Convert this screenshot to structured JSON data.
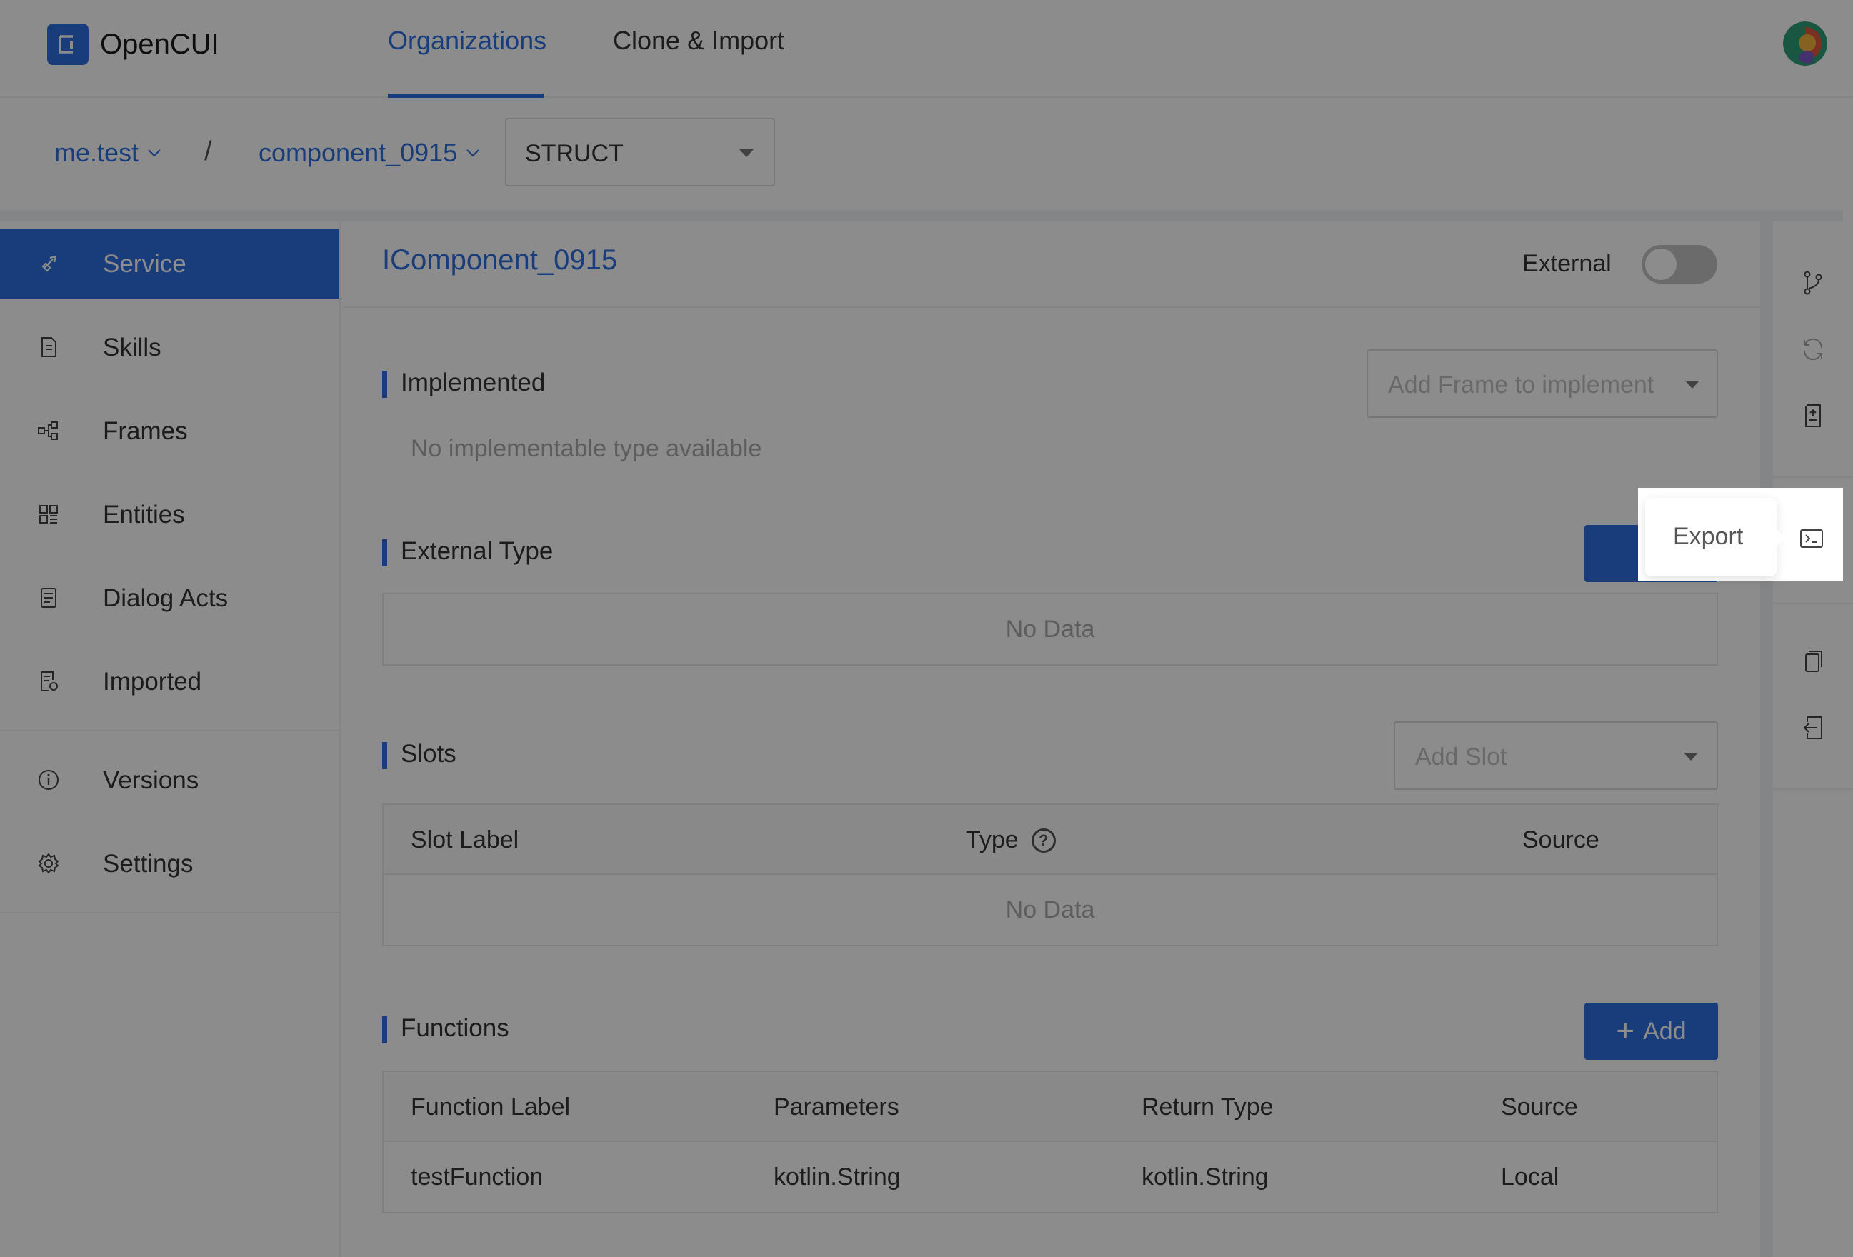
{
  "app": {
    "name": "OpenCUI",
    "accent": "#2f6fe0"
  },
  "nav": {
    "tabs": [
      {
        "label": "Organizations",
        "active": true
      },
      {
        "label": "Clone & Import",
        "active": false
      }
    ]
  },
  "breadcrumb": {
    "org": "me.test",
    "separator": "/",
    "project": "component_0915",
    "type_value": "STRUCT"
  },
  "sidebar": {
    "items": [
      {
        "label": "Service",
        "icon": "rocket-icon",
        "active": true
      },
      {
        "label": "Skills",
        "icon": "document-icon"
      },
      {
        "label": "Frames",
        "icon": "frames-icon"
      },
      {
        "label": "Entities",
        "icon": "entities-icon"
      },
      {
        "label": "Dialog Acts",
        "icon": "dialog-acts-icon"
      },
      {
        "label": "Imported",
        "icon": "imported-icon"
      },
      {
        "label": "Versions",
        "icon": "info-icon"
      },
      {
        "label": "Settings",
        "icon": "gear-icon"
      }
    ]
  },
  "main": {
    "title": "IComponent_0915",
    "external": {
      "label": "External",
      "enabled": false
    },
    "implemented": {
      "title": "Implemented",
      "select_placeholder": "Add Frame to implement",
      "empty_text": "No implementable type available"
    },
    "external_type": {
      "title": "External Type",
      "add_label": "+",
      "empty_text": "No Data"
    },
    "slots": {
      "title": "Slots",
      "select_placeholder": "Add Slot",
      "columns": [
        "Slot Label",
        "Type",
        "Source"
      ],
      "empty_text": "No Data"
    },
    "functions": {
      "title": "Functions",
      "add_label": "Add",
      "columns": [
        "Function Label",
        "Parameters",
        "Return Type",
        "Source"
      ],
      "rows": [
        [
          "testFunction",
          "kotlin.String",
          "kotlin.String",
          "Local"
        ]
      ]
    }
  },
  "right_panel": {
    "icons": [
      "branch-icon",
      "sync-icon",
      "upload-doc-icon",
      "export-icon",
      "copy-icon",
      "import-icon"
    ],
    "tooltip": "Export"
  }
}
